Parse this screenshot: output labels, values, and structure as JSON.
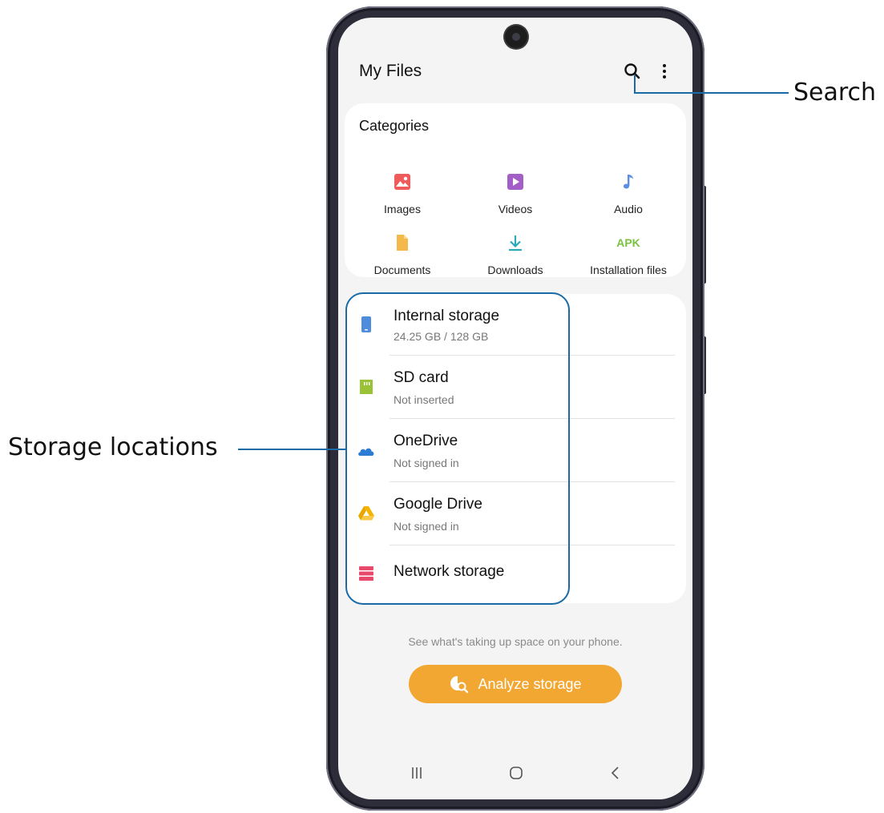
{
  "app": {
    "title": "My Files"
  },
  "toolbar": {
    "search_icon": "search-icon",
    "more_icon": "more-vertical-icon"
  },
  "categories": {
    "title": "Categories",
    "items": [
      {
        "label": "Images",
        "icon": "image-icon",
        "color": "#ef5a5a"
      },
      {
        "label": "Videos",
        "icon": "video-icon",
        "color": "#a45ec8"
      },
      {
        "label": "Audio",
        "icon": "music-note-icon",
        "color": "#5d8de4"
      },
      {
        "label": "Documents",
        "icon": "document-icon",
        "color": "#f5b84a"
      },
      {
        "label": "Downloads",
        "icon": "download-icon",
        "color": "#2ba9b8"
      },
      {
        "label": "Installation files",
        "icon": "apk-icon",
        "icon_text": "APK",
        "color": "#7ac142"
      }
    ]
  },
  "storage": {
    "items": [
      {
        "name": "Internal storage",
        "detail": "24.25 GB / 128 GB",
        "icon": "phone-icon",
        "color": "#4e8cde"
      },
      {
        "name": "SD card",
        "detail": "Not inserted",
        "icon": "sd-card-icon",
        "color": "#9ac236"
      },
      {
        "name": "OneDrive",
        "detail": "Not signed in",
        "icon": "cloud-icon",
        "color": "#2b7cd3"
      },
      {
        "name": "Google Drive",
        "detail": "Not signed in",
        "icon": "google-drive-icon",
        "color": "#f4b400"
      },
      {
        "name": "Network storage",
        "detail": "",
        "icon": "server-icon",
        "color": "#e74a6b"
      }
    ]
  },
  "analyze": {
    "hint": "See what's taking up space on your phone.",
    "button_label": "Analyze storage",
    "color": "#f3a733"
  },
  "nav": {
    "recents_icon": "recents-icon",
    "home_icon": "home-icon",
    "back_icon": "back-icon"
  },
  "callouts": {
    "search": "Search",
    "storage_locations": "Storage locations",
    "color": "#1a6aa6"
  }
}
